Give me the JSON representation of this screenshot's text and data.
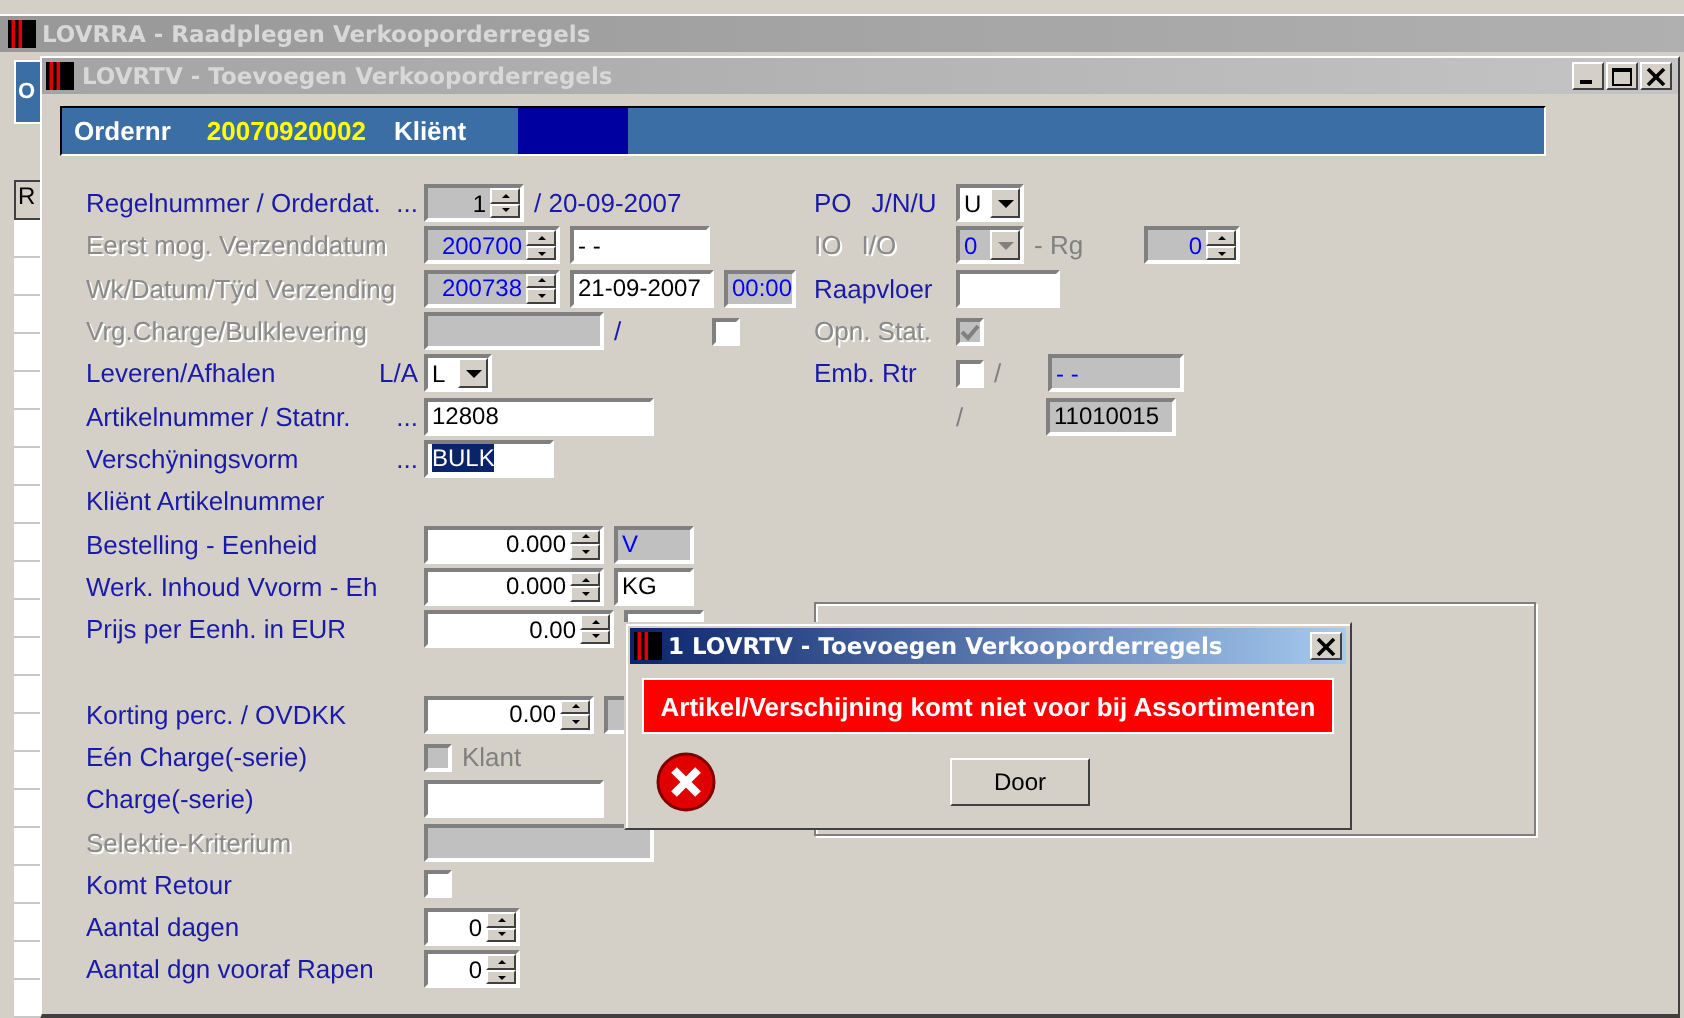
{
  "outer_window": {
    "title": "LOVRRA - Raadplegen Verkooporderregels",
    "side_tab": "O",
    "side_header": "R"
  },
  "window": {
    "title": "LOVRTV - Toevoegen Verkooporderregels"
  },
  "header": {
    "order_label": "Ordernr",
    "order_number": "20070920002",
    "client_label": "Kliënt"
  },
  "rows": [
    {
      "label": "Regelnummer / Orderdat.",
      "disabled": false,
      "suffix": "...",
      "widgets": [
        {
          "kind": "spin",
          "value": "1",
          "readonly": true
        },
        {
          "kind": "text",
          "text": "/ 20-09-2007"
        }
      ]
    },
    {
      "label": "Eerst mog. Verzenddatum",
      "disabled": true,
      "widgets": [
        {
          "kind": "spin",
          "value": "200700",
          "disabled": true
        },
        {
          "kind": "field",
          "value": "- -"
        }
      ]
    },
    {
      "label": "Wk/Datum/Tÿd Verzending",
      "disabled": true,
      "widgets": [
        {
          "kind": "spin",
          "value": "200738",
          "disabled": true
        },
        {
          "kind": "field",
          "value": "21-09-2007"
        },
        {
          "kind": "field",
          "value": "00:00",
          "disabled": true
        }
      ]
    },
    {
      "label": "Vrg.Charge/Bulklevering",
      "disabled": true,
      "widgets": [
        {
          "kind": "field",
          "disabled": true
        },
        {
          "kind": "text",
          "text": "/"
        },
        {
          "kind": "checkbox",
          "checked": false
        }
      ]
    },
    {
      "label": "Leveren/Afhalen",
      "disabled": false,
      "suffix": "L/A",
      "widgets": [
        {
          "kind": "dropdown",
          "value": "L"
        }
      ]
    },
    {
      "label": "Artikelnummer / Statnr.",
      "disabled": false,
      "suffix": "...",
      "widgets": [
        {
          "kind": "field",
          "value": "12808"
        }
      ]
    },
    {
      "label": "Verschÿningsvorm",
      "disabled": false,
      "suffix": "...",
      "widgets": [
        {
          "kind": "field",
          "value": "BULK",
          "highlighted": true
        }
      ]
    },
    {
      "label": "Kliënt Artikelnummer",
      "disabled": false,
      "widgets": []
    },
    {
      "label": "Bestelling - Eenheid",
      "disabled": false,
      "widgets": [
        {
          "kind": "spin",
          "value": "0.000"
        },
        {
          "kind": "field",
          "value": "V",
          "disabled": true
        }
      ]
    },
    {
      "label": "Werk. Inhoud Vvorm - Eh",
      "disabled": false,
      "widgets": [
        {
          "kind": "spin",
          "value": "0.000"
        },
        {
          "kind": "field",
          "value": "KG"
        }
      ]
    },
    {
      "label": "Prijs per Eenh. in EUR",
      "disabled": false,
      "widgets": [
        {
          "kind": "spin",
          "value": "0.00"
        },
        {
          "kind": "field"
        }
      ]
    },
    {
      "label": "Korting perc. / OVDKK",
      "disabled": false,
      "group_break": true,
      "widgets": [
        {
          "kind": "spin",
          "value": "0.00"
        },
        {
          "kind": "field",
          "disabled": true
        }
      ]
    },
    {
      "label": "Eén Charge(-serie)",
      "disabled": false,
      "widgets": [
        {
          "kind": "checkbox",
          "checked": false,
          "disabled": true
        },
        {
          "kind": "text",
          "text": "Klant",
          "disabled": true
        }
      ]
    },
    {
      "label": "Charge(-serie)",
      "disabled": false,
      "widgets": [
        {
          "kind": "field"
        }
      ]
    },
    {
      "label": "Selektie-Kriterium",
      "disabled": true,
      "widgets": [
        {
          "kind": "field",
          "disabled": true
        }
      ]
    },
    {
      "label": "Komt Retour",
      "disabled": false,
      "widgets": [
        {
          "kind": "checkbox",
          "checked": false
        }
      ]
    },
    {
      "label": "Aantal dagen",
      "disabled": false,
      "widgets": [
        {
          "kind": "spin",
          "value": "0"
        }
      ]
    },
    {
      "label": "Aantal dgn vooraf Rapen",
      "disabled": false,
      "widgets": [
        {
          "kind": "spin",
          "value": "0"
        }
      ]
    }
  ],
  "right_rows": [
    {
      "labels": [
        {
          "text": "PO",
          "disabled": false
        },
        {
          "text": "J/N/U",
          "disabled": false
        }
      ],
      "widgets": [
        {
          "kind": "dropdown",
          "value": "U"
        }
      ]
    },
    {
      "labels": [
        {
          "text": "IO",
          "disabled": true
        },
        {
          "text": "I/O",
          "disabled": true
        }
      ],
      "widgets": [
        {
          "kind": "dropdown",
          "value": "0",
          "disabled": true
        },
        {
          "kind": "text",
          "text": "- Rg",
          "disabled": true
        },
        {
          "kind": "spin",
          "value": "0",
          "disabled": true
        }
      ]
    },
    {
      "labels": [
        {
          "text": "Raapvloer",
          "disabled": false
        }
      ],
      "widgets": [
        {
          "kind": "field"
        }
      ]
    },
    {
      "labels": [
        {
          "text": "Opn. Stat.",
          "disabled": true
        }
      ],
      "widgets": [
        {
          "kind": "checkbox",
          "checked": true,
          "disabled": true
        }
      ]
    },
    {
      "labels": [
        {
          "text": "Emb. Rtr",
          "disabled": false
        }
      ],
      "widgets": [
        {
          "kind": "checkbox",
          "checked": false
        },
        {
          "kind": "text",
          "text": "/",
          "disabled": true
        },
        {
          "kind": "field",
          "value": "- -",
          "disabled": true
        }
      ]
    },
    {
      "widgets": [
        {
          "kind": "text",
          "text": "/",
          "disabled": true
        },
        {
          "kind": "field",
          "value": "11010015",
          "readonly": true
        }
      ]
    }
  ],
  "dialog": {
    "title": "1 LOVRTV - Toevoegen Verkooporderregels",
    "message": "Artikel/Verschijning komt niet voor bij Assortimenten",
    "button": "Door"
  }
}
